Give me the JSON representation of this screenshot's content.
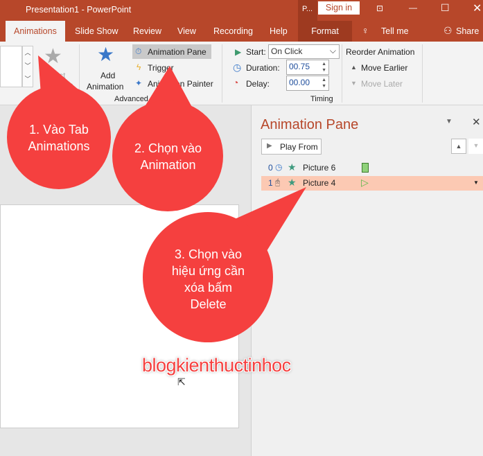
{
  "title_bar": {
    "title": "Presentation1  -  PowerPoint",
    "context_label": "P...",
    "sign_in": "Sign in"
  },
  "tabs": [
    {
      "label": "Animations",
      "active": true
    },
    {
      "label": "Slide Show"
    },
    {
      "label": "Review"
    },
    {
      "label": "View"
    },
    {
      "label": "Recording"
    },
    {
      "label": "Help"
    },
    {
      "label": "Format"
    }
  ],
  "tell_me": "Tell me",
  "share": "Share",
  "ribbon": {
    "effect_options": "Effect Options",
    "add_animation": "Add",
    "add_animation2": "Animation",
    "animation_pane": "Animation Pane",
    "trigger": "Trigger",
    "animation_painter": "Animation Painter",
    "group_advanced": "Advanced Animation",
    "start_label": "Start:",
    "start_value": "On Click",
    "duration_label": "Duration:",
    "duration_value": "00.75",
    "delay_label": "Delay:",
    "delay_value": "00.00",
    "group_timing": "Timing",
    "reorder": "Reorder Animation",
    "move_earlier": "Move Earlier",
    "move_later": "Move Later"
  },
  "pane": {
    "title": "Animation Pane",
    "play_from": "Play From",
    "items": [
      {
        "index": "0",
        "name": "Picture 6",
        "trigger": "clock-icon"
      },
      {
        "index": "1",
        "name": "Picture 4",
        "trigger": "mouse-icon",
        "selected": true
      }
    ]
  },
  "callouts": [
    "1. Vào Tab Animations",
    "2. Chọn vào Animation",
    "3. Chọn vào hiệu ứng cần xóa bấm Delete"
  ],
  "watermark": "blogkienthuctinhoc",
  "colors": {
    "accent": "#b7472a",
    "callout": "#f5403f",
    "selected_row": "#fcc9b3"
  }
}
